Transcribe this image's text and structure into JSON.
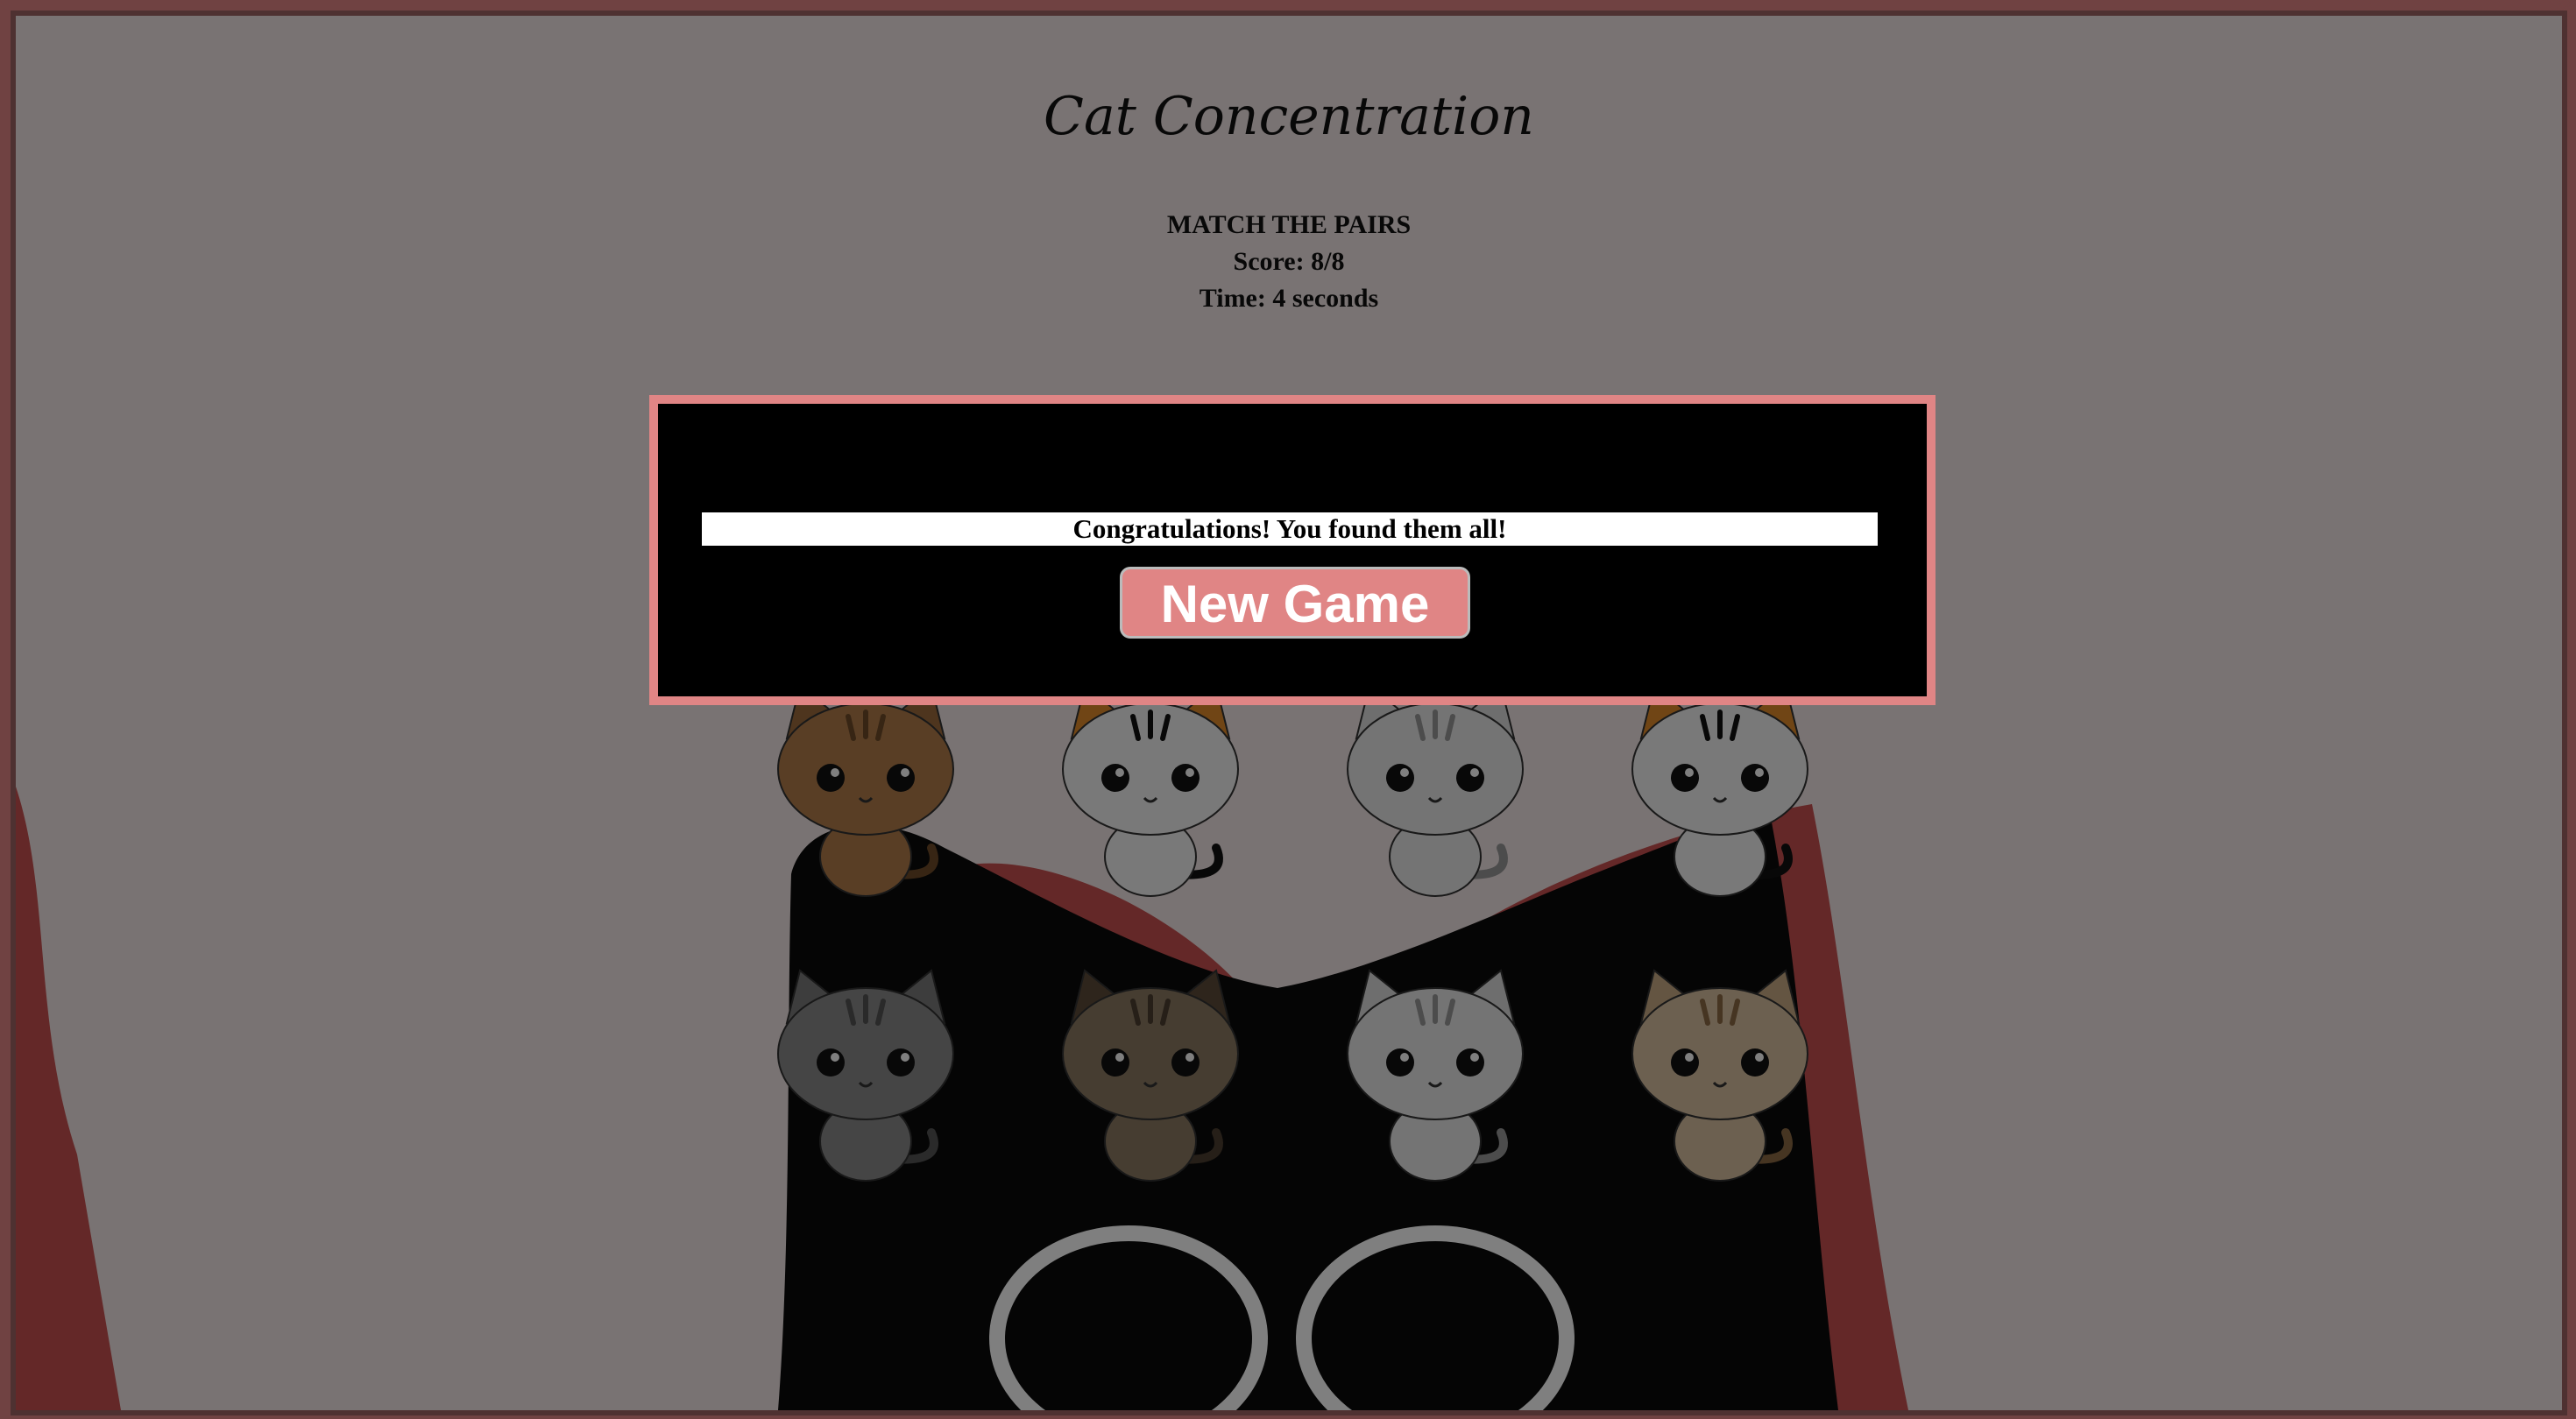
{
  "game": {
    "title": "Cat Concentration",
    "instruction": "MATCH THE PAIRS",
    "score": "Score: 8/8",
    "time": "Time: 4 seconds"
  },
  "modal": {
    "message": "Congratulations! You found them all!",
    "button_label": "New Game"
  },
  "board": {
    "rows": 3,
    "columns": 4,
    "cards": [
      {
        "cat": "black-cat",
        "fur": "#2a2a2a",
        "accent": "#444",
        "ears": "#222"
      },
      {
        "cat": "orange-tabby-cat",
        "fur": "#e28a2b",
        "accent": "#b85e14",
        "ears": "#d27a20"
      },
      {
        "cat": "orange-tabby-cat",
        "fur": "#e28a2b",
        "accent": "#b85e14",
        "ears": "#d27a20"
      },
      {
        "cat": "gray-tabby-cat",
        "fur": "#8a8a8a",
        "accent": "#555",
        "ears": "#7a7a7a"
      },
      {
        "cat": "brown-tabby-cat",
        "fur": "#b27d4b",
        "accent": "#6e4a28",
        "ears": "#9c6a3c"
      },
      {
        "cat": "calico-cat",
        "fur": "#f2f2f2",
        "accent": "#111",
        "ears": "#e08a2a"
      },
      {
        "cat": "white-bow-cat",
        "fur": "#e8e8e8",
        "accent": "#999",
        "ears": "#ddd"
      },
      {
        "cat": "calico-cat",
        "fur": "#f2f2f2",
        "accent": "#111",
        "ears": "#e08a2a"
      },
      {
        "cat": "gray-tabby-cat",
        "fur": "#8a8a8a",
        "accent": "#555",
        "ears": "#7a7a7a"
      },
      {
        "cat": "brown-cat",
        "fur": "#8c7a63",
        "accent": "#4d3f30",
        "ears": "#5c4b38"
      },
      {
        "cat": "white-bow-cat",
        "fur": "#e8e8e8",
        "accent": "#999",
        "ears": "#ddd"
      },
      {
        "cat": "beige-tabby-cat",
        "fur": "#d8c0a0",
        "accent": "#8c6a45",
        "ears": "#c8ab85"
      }
    ]
  },
  "colors": {
    "border": "#e08585",
    "background": "#f3e7e6",
    "modal": "#000000",
    "button": "#e08585"
  }
}
